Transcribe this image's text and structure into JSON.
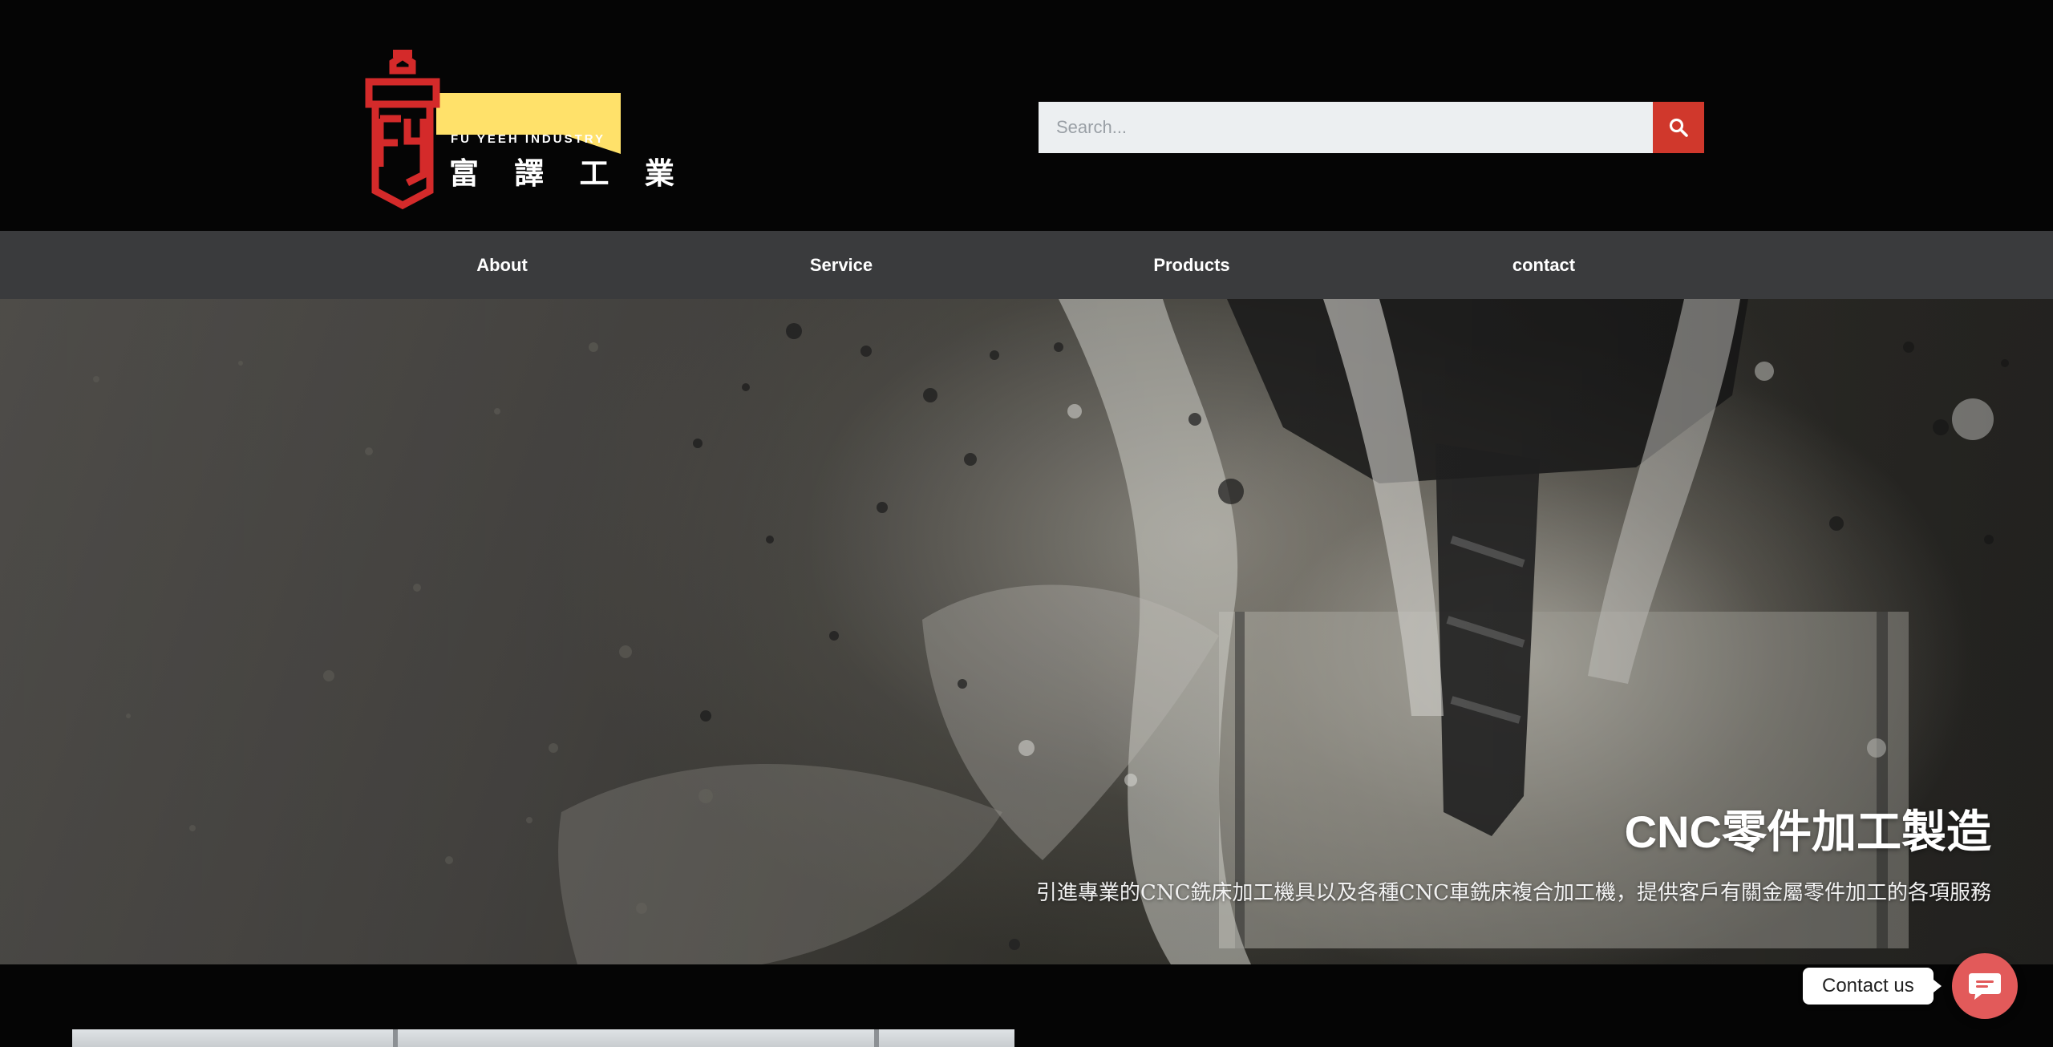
{
  "brand": {
    "name_en": "FU YEEH INDUSTRY",
    "name_zh": "富 譯 工 業",
    "colors": {
      "logo_red": "#d42a2a",
      "logo_yellow": "#ffe16a",
      "accent": "#d0382c"
    }
  },
  "search": {
    "placeholder": "Search...",
    "value": "",
    "icon": "search-icon"
  },
  "nav": {
    "items": [
      {
        "label": "About"
      },
      {
        "label": "Service"
      },
      {
        "label": "Products"
      },
      {
        "label": "contact"
      }
    ]
  },
  "hero": {
    "title": "CNC零件加工製造",
    "subtitle": "引進專業的CNC銑床加工機具以及各種CNC車銑床複合加工機，提供客戶有關金屬零件加工的各項服務"
  },
  "contact_widget": {
    "label": "Contact us",
    "icon": "chat-bubble-icon",
    "color": "#e25a5a"
  }
}
